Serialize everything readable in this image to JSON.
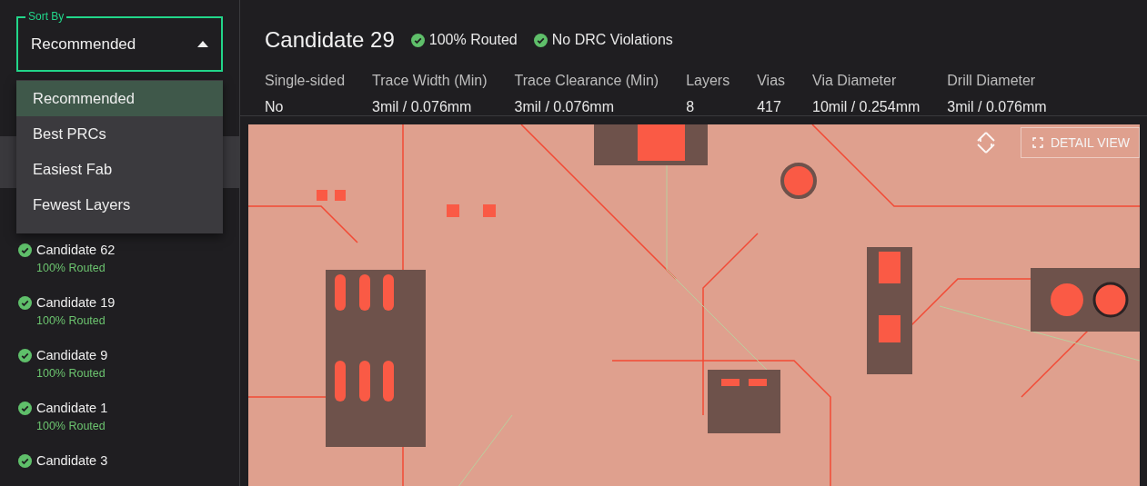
{
  "sort": {
    "label": "Sort By",
    "value": "Recommended",
    "expanded": true,
    "options": [
      {
        "label": "Recommended",
        "selected": true
      },
      {
        "label": "Best PRCs",
        "selected": false
      },
      {
        "label": "Easiest Fab",
        "selected": false
      },
      {
        "label": "Fewest Layers",
        "selected": false
      }
    ]
  },
  "candidates": [
    {
      "name": "Candidate 62",
      "status": "100% Routed"
    },
    {
      "name": "Candidate 19",
      "status": "100% Routed"
    },
    {
      "name": "Candidate 9",
      "status": "100% Routed"
    },
    {
      "name": "Candidate 1",
      "status": "100% Routed"
    },
    {
      "name": "Candidate 3"
    }
  ],
  "detail": {
    "title": "Candidate 29",
    "badges": [
      "100% Routed",
      "No DRC Violations"
    ],
    "specs": [
      {
        "label": "Single-sided",
        "value": "No"
      },
      {
        "label": "Trace Width (Min)",
        "value": "3mil / 0.076mm"
      },
      {
        "label": "Trace Clearance (Min)",
        "value": "3mil / 0.076mm"
      },
      {
        "label": "Layers",
        "value": "8"
      },
      {
        "label": "Vias",
        "value": "417"
      },
      {
        "label": "Via Diameter",
        "value": "10mil / 0.254mm"
      },
      {
        "label": "Drill Diameter",
        "value": "3mil / 0.076mm"
      }
    ]
  },
  "board": {
    "kind": "picture",
    "detail_button": "DETAIL VIEW"
  }
}
